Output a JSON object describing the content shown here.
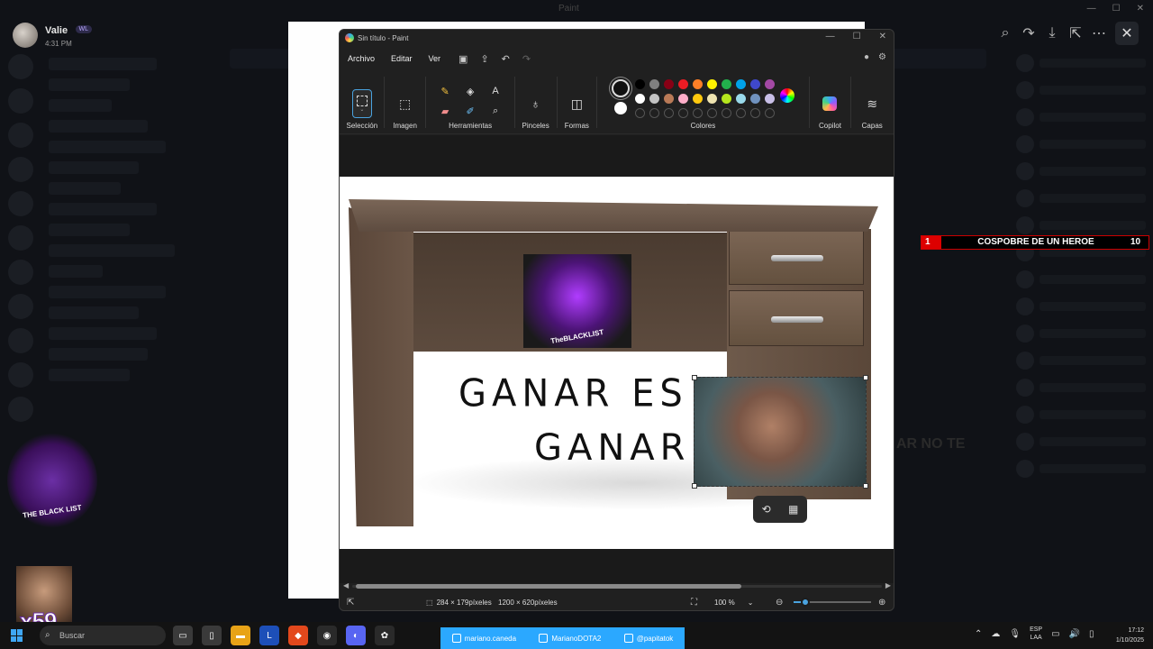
{
  "user": {
    "name": "Valie",
    "badge": "WL",
    "time": "4:31 PM"
  },
  "background_text": {
    "dark_heading": "AR NO TE",
    "window_title": "Paint"
  },
  "overlay": {
    "rank": "1",
    "title": "COSPOBRE DE UN HEROE",
    "count": "10"
  },
  "streamer": {
    "logo_text": "THE BLACK LIST",
    "counter": "x59"
  },
  "paint": {
    "title": "Sin título - Paint",
    "menu": [
      "Archivo",
      "Editar",
      "Ver"
    ],
    "ribbon": {
      "selection": "Selección",
      "image": "Imagen",
      "tools": "Herramientas",
      "brushes": "Pinceles",
      "shapes": "Formas",
      "colors": "Colores",
      "copilot": "Copilot",
      "layers": "Capas"
    },
    "palette": {
      "row1": [
        "#000000",
        "#7f7f7f",
        "#880015",
        "#ed1c24",
        "#ff7f27",
        "#fff200",
        "#22b14c",
        "#00a2e8",
        "#3f48cc",
        "#a349a4"
      ],
      "row2": [
        "#ffffff",
        "#c3c3c3",
        "#b97a57",
        "#ffaec9",
        "#ffc90e",
        "#efe4b0",
        "#b5e61d",
        "#99d9ea",
        "#7092be",
        "#c8bfe7"
      ]
    },
    "canvas": {
      "sticker_text": "TheBLACKLIST",
      "handwriting_line1": "GANAR ES",
      "handwriting_line2": "GANAR"
    },
    "status": {
      "selection_size": "284 × 179píxeles",
      "canvas_size": "1200 × 620píxeles",
      "zoom": "100 %",
      "zoom_level_fraction": 0.15
    }
  },
  "taskbar": {
    "search_placeholder": "Buscar",
    "socials": [
      "mariano.caneda",
      "MarianoDOTA2",
      "@papitatok"
    ],
    "lang_line1": "ESP",
    "lang_line2": "LAA",
    "time": "17:12",
    "date": "1/10/2025"
  },
  "colors": {
    "accent": "#4aa3df",
    "overlay_red": "#dd0000",
    "socials_bar": "#2ba8ff"
  }
}
